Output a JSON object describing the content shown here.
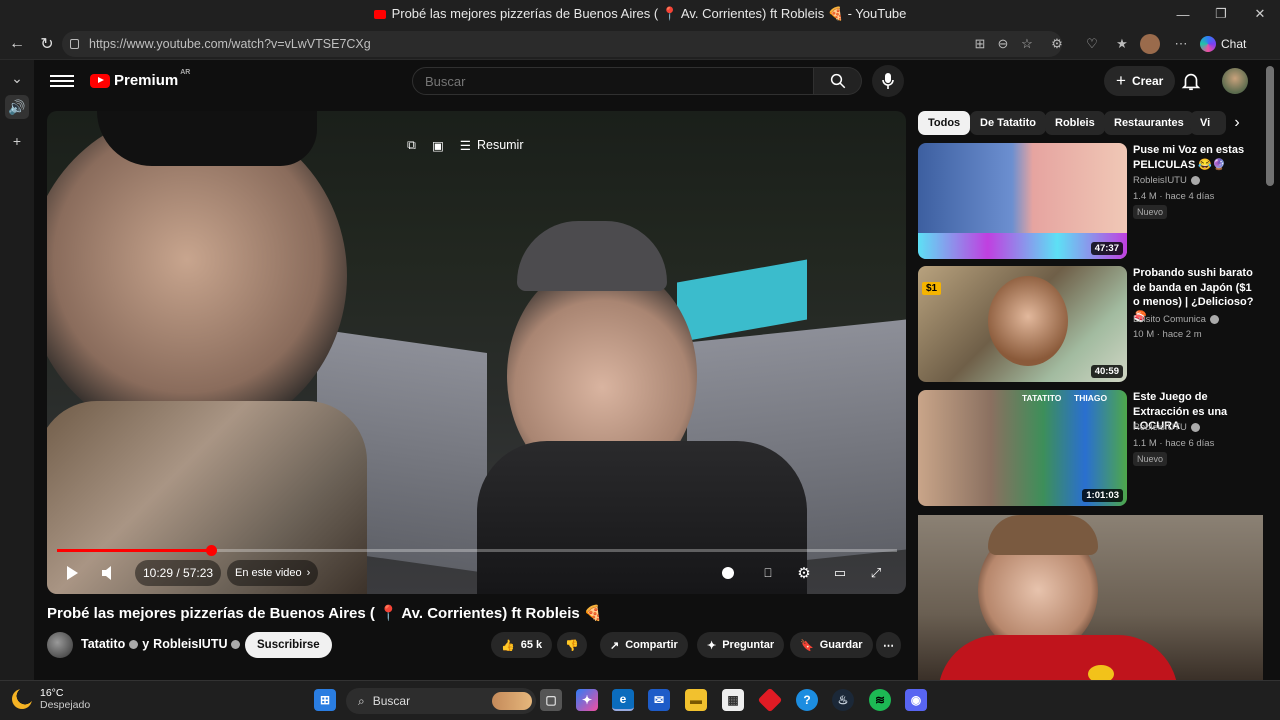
{
  "window": {
    "title": "Probé las mejores pizzerías de Buenos Aires ( 📍 Av. Corrientes) ft Robleis 🍕 - YouTube"
  },
  "browser": {
    "url": "https://www.youtube.com/watch?v=vLwVTSE7CXg",
    "chat_label": "Chat"
  },
  "youtube": {
    "logo": "Premium",
    "country": "AR",
    "search_placeholder": "Buscar",
    "create_label": "Crear"
  },
  "player": {
    "summarize_label": "Resumir",
    "time": "10:29 / 57:23",
    "chapter_label": "En este video",
    "progress_fraction": 0.183
  },
  "video": {
    "title": "Probé las mejores pizzerías de Buenos Aires ( 📍 Av. Corrientes) ft Robleis 🍕",
    "channel": "Tatatito",
    "channel_joiner": "y",
    "channel2": "RobleisIUTU",
    "subscribe_label": "Suscribirse",
    "likes": "65 k",
    "share_label": "Compartir",
    "ask_label": "Preguntar",
    "save_label": "Guardar"
  },
  "chips": [
    "Todos",
    "De Tatatito",
    "Robleis",
    "Restaurantes",
    "Vi"
  ],
  "recommendations": [
    {
      "title": "Puse mi Voz en estas PELICULAS 😂🔮",
      "channel": "RobleisIUTU",
      "meta": "1.4 M · hace 4 días",
      "new": "Nuevo",
      "duration": "47:37"
    },
    {
      "title": "Probando sushi barato de banda en Japón ($1 o menos) | ¿Delicioso? 🍣",
      "channel": "Luisito Comunica",
      "meta": "10 M · hace 2 m",
      "new": "",
      "duration": "40:59",
      "badge": "$1"
    },
    {
      "title": "Este Juego de Extracción es una LOCURA",
      "channel": "RobleisIUTU",
      "meta": "1.1 M · hace 6 días",
      "new": "Nuevo",
      "duration": "1:01:03",
      "thumb_labels": [
        "TATATITO",
        "THIAGO"
      ]
    }
  ],
  "taskbar": {
    "temperature": "16°C",
    "weather": "Despejado",
    "search_label": "Buscar"
  },
  "colors": {
    "background": "#0f0f0f",
    "accent_red": "#ff0000",
    "surface": "#272727"
  }
}
